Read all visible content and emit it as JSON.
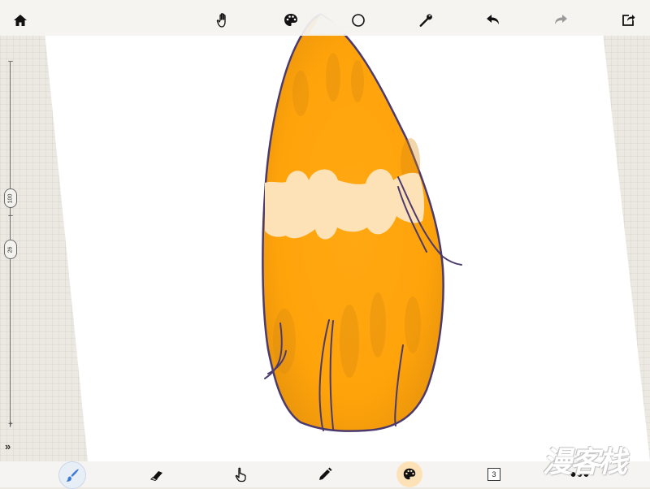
{
  "app": {
    "accent_color": "#3a7bd5",
    "paper_color": "#ffffff",
    "background_color": "#ece8e2"
  },
  "top_toolbar": {
    "items": [
      {
        "name": "home-icon"
      },
      {
        "name": "hand-icon"
      },
      {
        "name": "palette-icon"
      },
      {
        "name": "circle-icon"
      },
      {
        "name": "wrench-icon"
      },
      {
        "name": "undo-icon"
      },
      {
        "name": "redo-icon"
      },
      {
        "name": "share-icon"
      }
    ]
  },
  "left_panel": {
    "brush_size": "100",
    "opacity": "26",
    "plus_label": "+",
    "minus_label": "–",
    "expand_label": "»"
  },
  "bottom_toolbar": {
    "items": [
      {
        "name": "brush-icon",
        "active": true
      },
      {
        "name": "eraser-icon"
      },
      {
        "name": "finger-smudge-icon"
      },
      {
        "name": "pencil-icon"
      },
      {
        "name": "color-palette-icon",
        "active": true,
        "color": "#fde2b8"
      },
      {
        "name": "layers-icon"
      },
      {
        "name": "more-icon"
      }
    ],
    "layers_count": "3",
    "more_label": "•••"
  },
  "watermark": {
    "text": "漫客栈"
  },
  "canvas": {
    "fill_color": "#ffa60d",
    "highlight_color": "#fde2b8",
    "outline_color": "#4b3a6e"
  }
}
